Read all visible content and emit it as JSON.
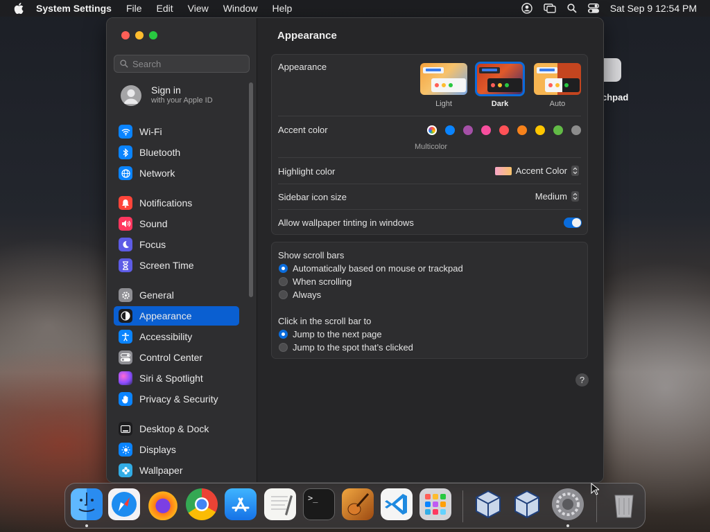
{
  "menubar": {
    "app_name": "System Settings",
    "menus": [
      "File",
      "Edit",
      "View",
      "Window",
      "Help"
    ],
    "clock": "Sat Sep 9  12:54 PM",
    "status_icons": [
      "user-icon",
      "screen-mirroring-icon",
      "spotlight-search-icon",
      "control-center-icon"
    ]
  },
  "desktop": {
    "icon_label": "chpad"
  },
  "sidebar": {
    "search_placeholder": "Search",
    "account": {
      "name": "Sign in",
      "sub": "with your Apple ID"
    },
    "items": [
      {
        "label": "Wi-Fi",
        "icon": "wifi-icon",
        "color": "#0a84ff"
      },
      {
        "label": "Bluetooth",
        "icon": "bluetooth-icon",
        "color": "#0a84ff"
      },
      {
        "label": "Network",
        "icon": "globe-icon",
        "color": "#0a84ff"
      },
      {
        "label": "Notifications",
        "icon": "bell-icon",
        "color": "#ff453a"
      },
      {
        "label": "Sound",
        "icon": "speaker-icon",
        "color": "#ff375f"
      },
      {
        "label": "Focus",
        "icon": "moon-icon",
        "color": "#5e5ce6"
      },
      {
        "label": "Screen Time",
        "icon": "hourglass-icon",
        "color": "#5e5ce6"
      },
      {
        "label": "General",
        "icon": "gear-icon",
        "color": "#8e8e93"
      },
      {
        "label": "Appearance",
        "icon": "appearance-icon",
        "color": "#1c1c1e"
      },
      {
        "label": "Accessibility",
        "icon": "accessibility-icon",
        "color": "#0a84ff"
      },
      {
        "label": "Control Center",
        "icon": "toggles-icon",
        "color": "#8e8e93"
      },
      {
        "label": "Siri & Spotlight",
        "icon": "siri-icon",
        "color": "#bf5af2"
      },
      {
        "label": "Privacy & Security",
        "icon": "hand-icon",
        "color": "#0a84ff"
      },
      {
        "label": "Desktop & Dock",
        "icon": "dock-icon",
        "color": "#1c1c1e"
      },
      {
        "label": "Displays",
        "icon": "sun-icon",
        "color": "#0a84ff"
      },
      {
        "label": "Wallpaper",
        "icon": "flower-icon",
        "color": "#32ade6"
      }
    ],
    "selected": "Appearance"
  },
  "content": {
    "title": "Appearance",
    "appearance": {
      "label": "Appearance",
      "options": [
        "Light",
        "Dark",
        "Auto"
      ],
      "selected": "Dark"
    },
    "accent": {
      "label": "Accent color",
      "selected_label": "Multicolor",
      "colors": [
        "multicolor",
        "#0a84ff",
        "#a550a7",
        "#f74f9e",
        "#ff5257",
        "#f7821b",
        "#ffc600",
        "#62ba46",
        "#8c8c8c"
      ]
    },
    "highlight": {
      "label": "Highlight color",
      "value": "Accent Color"
    },
    "sidebar_icon_size": {
      "label": "Sidebar icon size",
      "value": "Medium"
    },
    "wallpaper_tinting": {
      "label": "Allow wallpaper tinting in windows",
      "enabled": true
    },
    "scroll_bars": {
      "label": "Show scroll bars",
      "options": [
        "Automatically based on mouse or trackpad",
        "When scrolling",
        "Always"
      ],
      "selected": 0
    },
    "click_scroll": {
      "label": "Click in the scroll bar to",
      "options": [
        "Jump to the next page",
        "Jump to the spot that’s clicked"
      ],
      "selected": 0
    },
    "help": "?"
  },
  "dock": {
    "apps": [
      {
        "name": "Finder",
        "icon": "finder-icon",
        "color": "#2a8cf0",
        "running": true
      },
      {
        "name": "Safari",
        "icon": "safari-icon",
        "color": "#1d8cf0",
        "running": false
      },
      {
        "name": "Firefox",
        "icon": "firefox-icon",
        "color": "#ff7a18",
        "running": false
      },
      {
        "name": "Chrome",
        "icon": "chrome-icon",
        "color": "#e8e8e8",
        "running": false
      },
      {
        "name": "App Store",
        "icon": "app-store-icon",
        "color": "#1e90ff",
        "running": false
      },
      {
        "name": "TextEdit",
        "icon": "textedit-icon",
        "color": "#f2f2f2",
        "running": false
      },
      {
        "name": "Terminal",
        "icon": "terminal-icon",
        "color": "#1a1a1a",
        "running": false
      },
      {
        "name": "GarageBand",
        "icon": "guitar-icon",
        "color": "#d48a2a",
        "running": false
      },
      {
        "name": "Visual Studio Code",
        "icon": "vscode-icon",
        "color": "#ffffff",
        "running": false
      },
      {
        "name": "Launchpad",
        "icon": "launchpad-icon",
        "color": "#d4d4d8",
        "running": false
      },
      {
        "name": "VirtualBox",
        "icon": "virtualbox-icon",
        "color": "#c9d7ea",
        "running": false
      },
      {
        "name": "VirtualBox VM",
        "icon": "virtualbox-icon",
        "color": "#c9d7ea",
        "running": false
      },
      {
        "name": "System Settings",
        "icon": "system-settings-icon",
        "color": "#8e8e93",
        "running": true
      },
      {
        "name": "Trash",
        "icon": "trash-icon",
        "color": "#b5b5b8",
        "running": false
      }
    ],
    "terminal_prompt": ">_"
  }
}
